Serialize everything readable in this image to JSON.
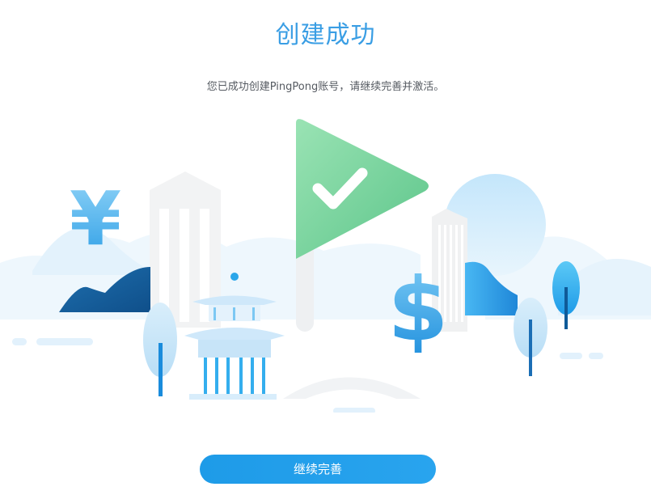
{
  "page": {
    "title": "创建成功",
    "message": "您已成功创建PingPong账号，请继续完善并激活。"
  },
  "actions": {
    "continue_label": "继续完善"
  },
  "illustration": {
    "currency_symbols": [
      "¥",
      "$"
    ],
    "flag_icon": "check-icon"
  },
  "colors": {
    "accent": "#3a9ee4",
    "button": "#1e9be8",
    "flag_green": "#6dcf95",
    "text_muted": "#555a61"
  }
}
